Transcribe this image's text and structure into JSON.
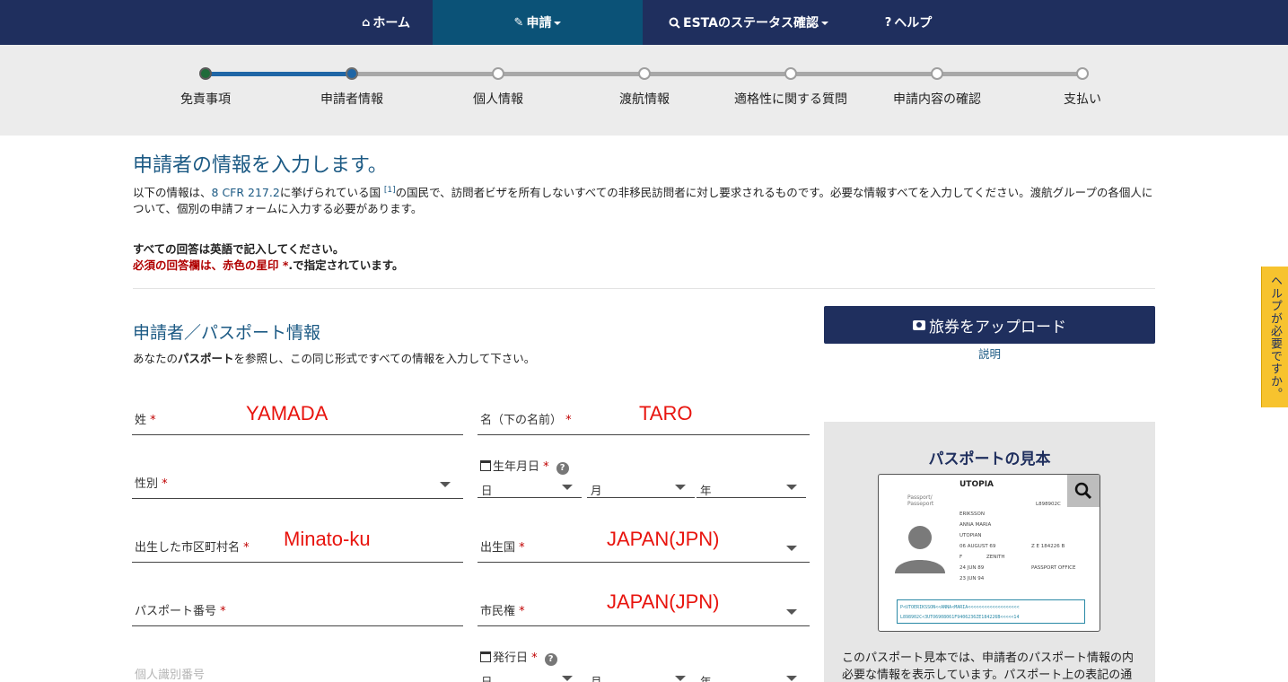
{
  "nav": {
    "items": [
      {
        "icon": "home-icon",
        "glyph": "⌂",
        "label": "ホーム"
      },
      {
        "icon": "pencil-icon",
        "glyph": "✎",
        "label": "申請"
      },
      {
        "icon": "search-icon",
        "glyph": "🔍",
        "label": "ESTAのステータス確認"
      },
      {
        "icon": "question-icon",
        "glyph": "?",
        "label": "ヘルプ"
      }
    ],
    "active_index": 1
  },
  "progress": {
    "steps": [
      "免責事項",
      "申請者情報",
      "個人情報",
      "渡航情報",
      "適格性に関する質問",
      "申請内容の確認",
      "支払い"
    ],
    "current_index": 1
  },
  "page": {
    "title": "申請者の情報を入力します。",
    "intro_before": "以下の情報は、",
    "intro_link": "8 CFR 217.2",
    "intro_middle": "に挙げられている国 ",
    "intro_ref": "[1]",
    "intro_after": "の国民で、訪問者ビザを所有しないすべての非移民訪問者に対し要求されるものです。必要な情報すべてを入力してください。渡航グループの各個人について、個別の申請フォームに入力する必要があります。",
    "note_english": "すべての回答は英語で記入してください。",
    "note_required": "必須の回答欄は、赤色の星印 *",
    "note_required_tail": ".で指定されています。"
  },
  "section": {
    "title": "申請者／パスポート情報",
    "desc_before": "あなたの",
    "desc_bold": "パスポート",
    "desc_after": "を参照し、この同じ形式ですべての情報を入力して下さい。"
  },
  "required_mark": "*",
  "fields": {
    "surname": {
      "label": "姓",
      "value": "YAMADA"
    },
    "given_name": {
      "label": "名（下の名前）",
      "value": "TARO"
    },
    "gender": {
      "label": "性別"
    },
    "birth_date": {
      "label": "生年月日",
      "day": "日",
      "month": "月",
      "year": "年"
    },
    "birth_city": {
      "label": "出生した市区町村名",
      "value": "Minato-ku"
    },
    "birth_country": {
      "label": "出生国",
      "value": "JAPAN(JPN)"
    },
    "passport_number": {
      "label": "パスポート番号"
    },
    "citizenship": {
      "label": "市民権",
      "value": "JAPAN(JPN)"
    },
    "national_id": {
      "placeholder": "個人識別番号"
    },
    "issue_date": {
      "label": "発行日",
      "day": "日",
      "month": "月",
      "year": "年"
    }
  },
  "upload": {
    "button_label": "旅券をアップロード",
    "explain_link": "説明"
  },
  "help_tab": "ヘルプが必要ですか。",
  "sample": {
    "title": "パスポートの見本",
    "passport_country": "UTOPIA",
    "passport_word": "Passport/ Passeport",
    "surname": "ERIKSSON",
    "given_names": "ANNA MARIA",
    "nationality": "UTOPIAN",
    "birth": "06 AUGUST 69",
    "sex": "F",
    "place_of_birth": "ZENITH",
    "issue": "24 JUN 89",
    "expiry": "23 JUN 94",
    "authority": "PASSPORT OFFICE",
    "doc_no": "L898902C",
    "personal_no": "Z E 184226 B",
    "mrz_line1": "P<UTOERIKSSON<<ANNA<MARIA<<<<<<<<<<<<<<<<<<<",
    "mrz_line2": "L898902C<3UTO6908061F9406236ZE184226B<<<<<14",
    "text_line1": "このパスポート見本では、申請者のパスポート情報の内",
    "text_line2": "必要な情報を表示しています。パスポート上の表記の通"
  }
}
